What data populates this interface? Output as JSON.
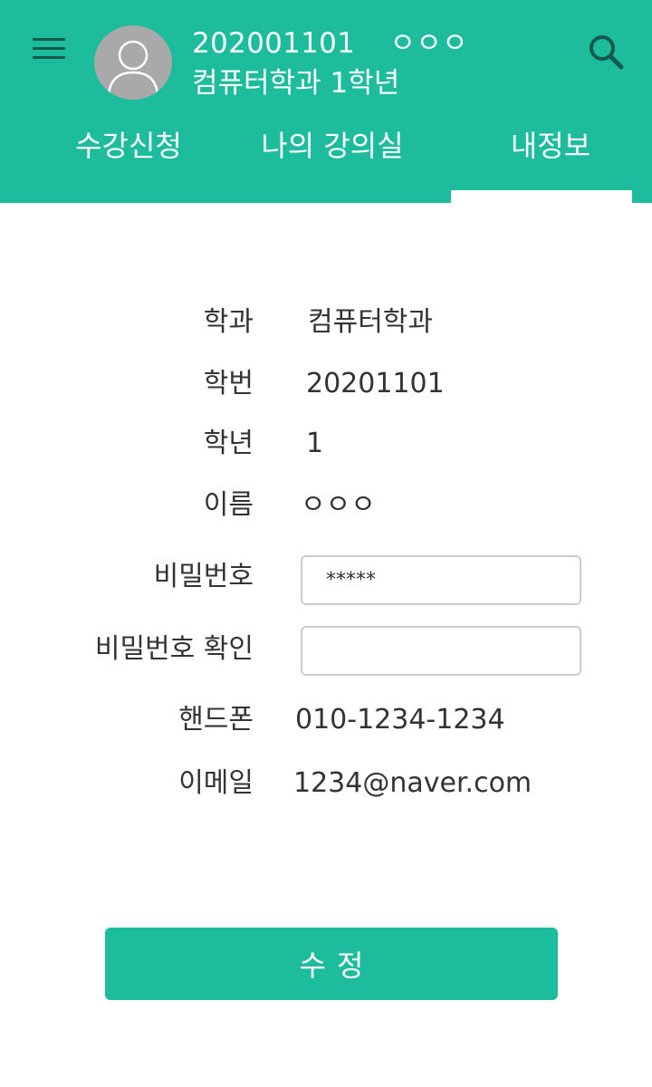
{
  "header": {
    "student_id": "202001101",
    "student_name": "ㅇㅇㅇ",
    "department_year": "컴퓨터학과 1학년",
    "menu_icon": "hamburger-menu-icon",
    "avatar_icon": "user-silhouette-icon",
    "search_icon": "search-icon"
  },
  "tabs": [
    {
      "label": "수강신청",
      "active": false
    },
    {
      "label": "나의 강의실",
      "active": false
    },
    {
      "label": "내정보",
      "active": true
    }
  ],
  "profile": {
    "department_label": "학과",
    "department_value": "컴퓨터학과",
    "student_no_label": "학번",
    "student_no_value": "20201101",
    "year_label": "학년",
    "year_value": "1",
    "name_label": "이름",
    "name_value": "ㅇㅇㅇ",
    "password_label": "비밀번호",
    "password_value": "*****",
    "password_confirm_label": "비밀번호 확인",
    "password_confirm_value": "",
    "phone_label": "핸드폰",
    "phone_value": "010-1234-1234",
    "email_label": "이메일",
    "email_value": "1234@naver.com"
  },
  "actions": {
    "submit_label": "수정"
  },
  "colors": {
    "accent": "#1dbc9c",
    "icon_dark": "#15594d",
    "avatar_bg": "#a9a9a9",
    "text": "#333333",
    "input_border": "#cccccc"
  }
}
